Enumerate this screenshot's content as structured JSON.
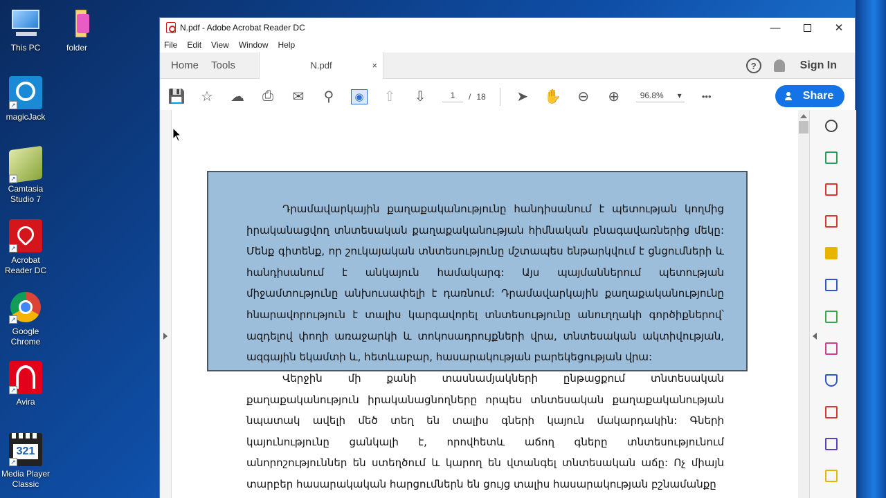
{
  "desktop": {
    "icons": [
      {
        "label": "This PC",
        "icon": "monitor-icon"
      },
      {
        "label": "folder",
        "icon": "folder-icon"
      },
      {
        "label": "magicJack",
        "icon": "magicjack-icon"
      },
      {
        "label": "Camtasia\nStudio 7",
        "icon": "camtasia-icon"
      },
      {
        "label": "Acrobat\nReader DC",
        "icon": "acrobat-icon"
      },
      {
        "label": "Google\nChrome",
        "icon": "chrome-icon"
      },
      {
        "label": "Avira",
        "icon": "avira-icon"
      },
      {
        "label": "Media Player\nClassic",
        "icon": "media-player-icon"
      }
    ]
  },
  "window": {
    "title": "N.pdf - Adobe Acrobat Reader DC",
    "menu": [
      "File",
      "Edit",
      "View",
      "Window",
      "Help"
    ],
    "tabs": {
      "home": "Home",
      "tools": "Tools",
      "doc": "N.pdf",
      "close": "×"
    },
    "signin": "Sign In",
    "help": "?",
    "page_current": "1",
    "page_sep": "/",
    "page_total": "18",
    "zoom": "96.8%",
    "more": "•••",
    "share": "Share"
  },
  "document": {
    "paragraph1": "Դրամավարկային քաղաքականությունը հանդիսանում է պետության կողմից իրականացվող տնտեսական քաղաքականության հիմնական բնագավառներից մեկը: Մենք գիտենք, որ շուկայական տնտեսությունը մշտապես ենթարկվում է ցնցումների և հանդիսանում է անկայուն համակարգ: Այս պայմաններում պետության միջամտությունը անխուսափելի է դառնում: Դրամավարկային քաղաքականությունը հնարավորություն է տալիս կարգավորել տնտեսությունը անուղղակի գործիքներով՝ ազդելով փողի առաջարկի և տոկոսադրույքների վրա, տնտեսական ակտիվության, ազգային եկամտի և, հետևաբար, հասարակության բարեկեցության վրա:",
    "paragraph2": "Վերջին մի քանի տասնամյակների ընթացքում տնտեսական քաղաքականություն իրականացնողները որպես տնտեսական քաղաքականության նպատակ ավելի մեծ տեղ են տալիս գների կայուն մակարդակին: Գների կայունությունը ցանկալի է, որովհետև աճող գները տնտեսությունում անորոշություններ են ստեղծում և կարող են վտանգել տնտեսական աճը: Ոչ միայն տարբեր հասարակական հարցումներն են ցույց տալիս հասարակության բշնամանքը"
  }
}
